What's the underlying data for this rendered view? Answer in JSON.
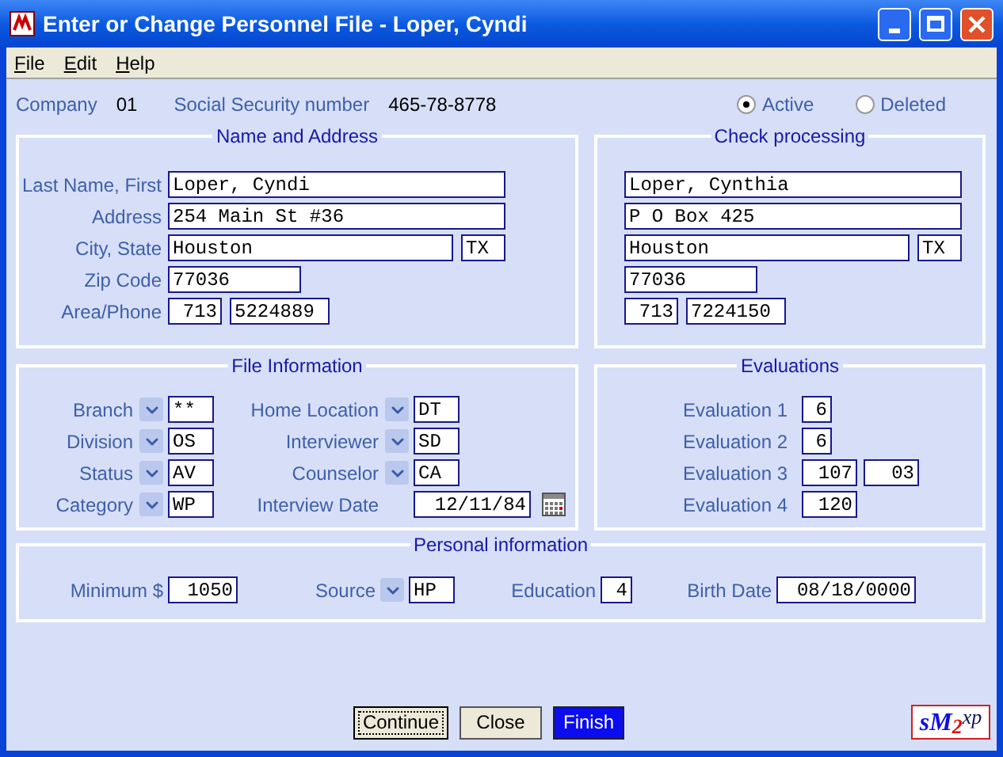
{
  "window": {
    "title": "Enter or Change Personnel File - Loper, Cyndi"
  },
  "menu": [
    {
      "label": "File"
    },
    {
      "label": "Edit"
    },
    {
      "label": "Help"
    }
  ],
  "header": {
    "company_label": "Company",
    "company": "01",
    "ssn_label": "Social Security number",
    "ssn": "465-78-8778",
    "status_options": [
      {
        "label": "Active",
        "selected": true
      },
      {
        "label": "Deleted",
        "selected": false
      }
    ]
  },
  "name_and_address": {
    "title": "Name and Address",
    "rows": [
      {
        "label": "Last Name, First",
        "fields": [
          "Loper, Cyndi"
        ]
      },
      {
        "label": "Address",
        "fields": [
          "254 Main St #36"
        ]
      },
      {
        "label": "City, State",
        "fields": [
          "Houston",
          "TX"
        ]
      },
      {
        "label": "Zip Code",
        "fields": [
          "77036"
        ]
      },
      {
        "label": "Area/Phone",
        "fields": [
          "713",
          "5224889"
        ]
      }
    ]
  },
  "check_processing": {
    "title": "Check processing",
    "rows": [
      {
        "fields": [
          "Loper, Cynthia"
        ]
      },
      {
        "fields": [
          "P O Box 425"
        ]
      },
      {
        "fields": [
          "Houston",
          "TX"
        ]
      },
      {
        "fields": [
          "77036"
        ]
      },
      {
        "fields": [
          "713",
          "7224150"
        ]
      }
    ]
  },
  "file_information": {
    "title": "File Information",
    "left": [
      {
        "label": "Branch",
        "kind": "dropdown",
        "value": "**"
      },
      {
        "label": "Division",
        "kind": "dropdown",
        "value": "OS"
      },
      {
        "label": "Status",
        "kind": "dropdown",
        "value": "AV"
      },
      {
        "label": "Category",
        "kind": "dropdown",
        "value": "WP"
      }
    ],
    "right": [
      {
        "label": "Home Location",
        "kind": "dropdown",
        "value": "DT"
      },
      {
        "label": "Interviewer",
        "kind": "dropdown",
        "value": "SD"
      },
      {
        "label": "Counselor",
        "kind": "dropdown",
        "value": "CA"
      },
      {
        "label": "Interview Date",
        "kind": "date",
        "value": "12/11/84"
      }
    ]
  },
  "evaluations": {
    "title": "Evaluations",
    "rows": [
      {
        "label": "Evaluation 1",
        "fields": [
          "6"
        ]
      },
      {
        "label": "Evaluation 2",
        "fields": [
          "6"
        ]
      },
      {
        "label": "Evaluation 3",
        "fields": [
          "107",
          "03"
        ]
      },
      {
        "label": "Evaluation 4",
        "fields": [
          "120"
        ]
      }
    ]
  },
  "personal_information": {
    "title": "Personal information",
    "items": [
      {
        "label": "Minimum $",
        "kind": "text",
        "value": "1050"
      },
      {
        "label": "Source",
        "kind": "dropdown",
        "value": "HP"
      },
      {
        "label": "Education",
        "kind": "text",
        "value": "4"
      },
      {
        "label": "Birth Date",
        "kind": "text",
        "value": "08/18/0000"
      }
    ]
  },
  "buttons": [
    {
      "label": "Continue",
      "kind": "default"
    },
    {
      "label": "Close",
      "kind": "normal"
    },
    {
      "label": "Finish",
      "kind": "primary"
    }
  ],
  "logo": {
    "parts": [
      {
        "text": "s",
        "color": "#1010e0"
      },
      {
        "text": "M",
        "color": "#1010e0"
      },
      {
        "text": "2",
        "color": "#e01010"
      },
      {
        "text": "xp",
        "color": "#101060"
      }
    ]
  }
}
